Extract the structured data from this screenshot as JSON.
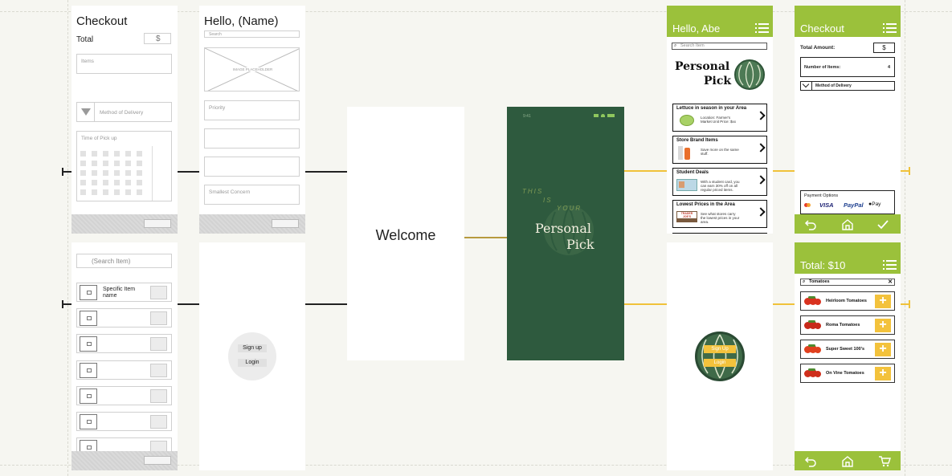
{
  "wireframes": {
    "checkout": {
      "title": "Checkout",
      "total_label": "Total",
      "currency": "$",
      "items_placeholder": "Items",
      "delivery_label": "Method of Delivery",
      "pickup_label": "Time of Pick up"
    },
    "home": {
      "title": "Hello, (Name)",
      "search_placeholder": "Search",
      "image_placeholder": "IMAGE PLACEHOLDER",
      "priority_label": "Priority",
      "concern_label": "Smallest Concern"
    },
    "search": {
      "search_placeholder": "(Search Item)",
      "first_item": "Specific Item name"
    },
    "auth": {
      "signup_label": "Sign up",
      "login_label": "Login"
    },
    "welcome": {
      "title": "Welcome"
    }
  },
  "splash": {
    "status_time": "9:41",
    "tag_this": "THIS",
    "tag_is": "IS",
    "tag_your": "YOUR",
    "brand_line1": "Personal",
    "brand_line2": "Pick"
  },
  "hifi_home": {
    "greeting": "Hello, Abe",
    "search_placeholder": "Search Item",
    "brand_line1": "Personal",
    "brand_line2": "Pick",
    "cards": [
      {
        "title": "Lettuce in season in your Area",
        "desc": "Location: Farmer's Market Unit Price: $xx"
      },
      {
        "title": "Store Brand Items",
        "desc": "Save more on the same stuff."
      },
      {
        "title": "Student Deals",
        "desc": "With a student card, you can earn 30% off on all regular priced items."
      },
      {
        "title": "Lowest Prices in the Area",
        "desc": "See what stores carry the lowest prices in your area."
      }
    ],
    "store_logo": "TRADER JOE'S"
  },
  "hifi_checkout": {
    "title": "Checkout",
    "total_label": "Total Amount:",
    "currency": "$",
    "items_label": "Number of Items:",
    "items_count": "4",
    "delivery_label": "Method of Delivery",
    "payment_title": "Payment Options",
    "payment_methods": [
      "VISA",
      "PayPal",
      "Pay"
    ]
  },
  "hifi_auth": {
    "signup_label": "Sign Up",
    "login_label": "Login"
  },
  "hifi_cart": {
    "total": "Total: $10",
    "search_value": "Tomatoes",
    "items": [
      "Heirloom Tomatoes",
      "Roma Tomatoes",
      "Super Sweet 100's",
      "On Vine Tomatoes"
    ],
    "plus_symbol": "+"
  },
  "colors": {
    "accent_green": "#9bc13b",
    "splash_green": "#2e5a3e",
    "yellow": "#f0c23a"
  }
}
